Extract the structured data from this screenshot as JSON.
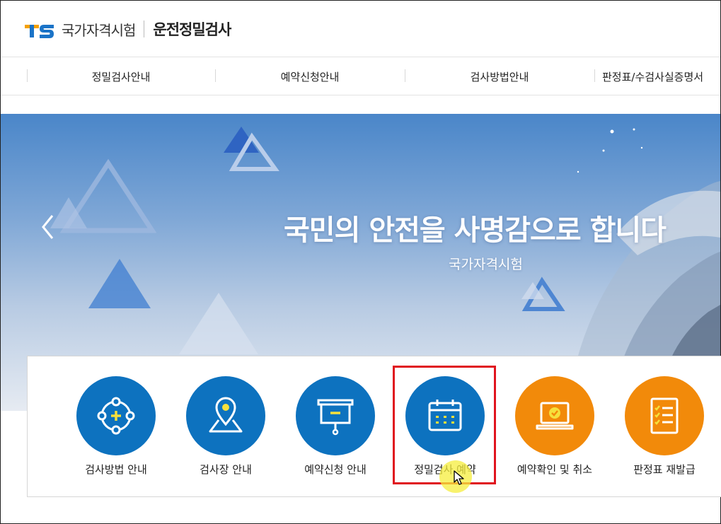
{
  "header": {
    "logo_mark": "TS",
    "org_name": "국가자격시험",
    "service_name": "운전정밀검사"
  },
  "nav": {
    "items": [
      {
        "label": "정밀검사안내"
      },
      {
        "label": "예약신청안내"
      },
      {
        "label": "검사방법안내"
      },
      {
        "label": "판정표/수검사실증명서"
      }
    ]
  },
  "banner": {
    "title": "국민의 안전을 사명감으로 합니다",
    "subtitle": "국가자격시험"
  },
  "quick_menu": {
    "items": [
      {
        "label": "검사방법 안내",
        "icon": "crosshair-plus-icon",
        "color": "#0d72bf"
      },
      {
        "label": "검사장 안내",
        "icon": "map-pin-icon",
        "color": "#0d72bf"
      },
      {
        "label": "예약신청 안내",
        "icon": "presentation-board-icon",
        "color": "#0d72bf"
      },
      {
        "label": "정밀검사 예약",
        "icon": "calendar-icon",
        "color": "#0d72bf"
      },
      {
        "label": "예약확인 및 취소",
        "icon": "laptop-check-icon",
        "color": "#f28a0a"
      },
      {
        "label": "판정표 재발급",
        "icon": "checklist-icon",
        "color": "#f28a0a"
      }
    ]
  },
  "colors": {
    "primary_blue": "#0d72bf",
    "accent_orange": "#f28a0a",
    "highlight_red": "#e0141e",
    "icon_yellow": "#f6e03c"
  }
}
